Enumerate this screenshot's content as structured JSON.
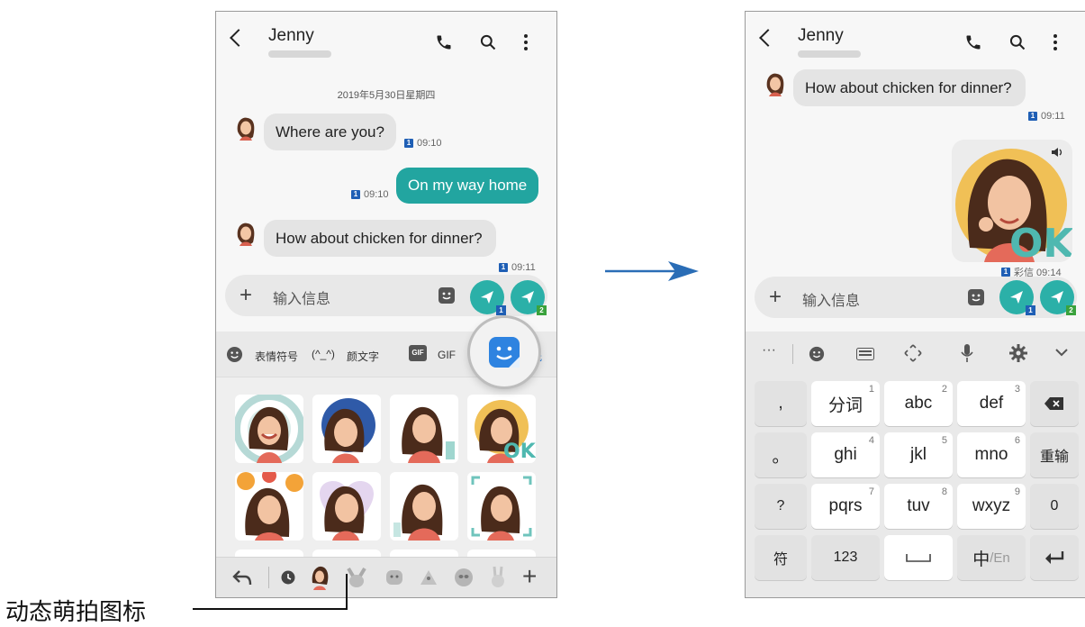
{
  "left": {
    "contact": "Jenny",
    "date": "2019年5月30日星期四",
    "messages": [
      {
        "text": "Where are you?",
        "time": "09:10",
        "sim": "1"
      },
      {
        "text": "On my way home",
        "time": "09:10",
        "sim": "1"
      },
      {
        "text": "How about chicken for dinner?",
        "time": "09:11",
        "sim": "1"
      }
    ],
    "input_placeholder": "输入信息",
    "sim1": "1",
    "sim2": "2",
    "tabs": {
      "emoji": "表情符号",
      "kaomoji_icon": "(^_^)",
      "kaomoji": "颜文字",
      "gif_icon": "GIF",
      "gif": "GIF",
      "sticker_suffix": "纸"
    }
  },
  "right": {
    "contact": "Jenny",
    "msg": "How about chicken for dinner?",
    "msg_time": "09:11",
    "sticker_sim": "1",
    "sticker_meta": "彩信 09:14",
    "input_placeholder": "输入信息",
    "sim1": "1",
    "sim2": "2",
    "keys": {
      "r1": [
        ",",
        "分词",
        "abc",
        "def"
      ],
      "r1_sup": [
        "1",
        "2",
        "3"
      ],
      "r2": [
        "。",
        "ghi",
        "jkl",
        "mno",
        "重输"
      ],
      "r2_sup": [
        "4",
        "5",
        "6"
      ],
      "r3": [
        "?",
        "pqrs",
        "tuv",
        "wxyz",
        "0"
      ],
      "r3_sup": [
        "7",
        "8",
        "9"
      ],
      "r4": [
        "符",
        "123",
        "中",
        "/En"
      ]
    }
  },
  "annotation": "动态萌拍图标",
  "colors": {
    "accent": "#22a5a0",
    "sim": "#1f5fb5"
  }
}
